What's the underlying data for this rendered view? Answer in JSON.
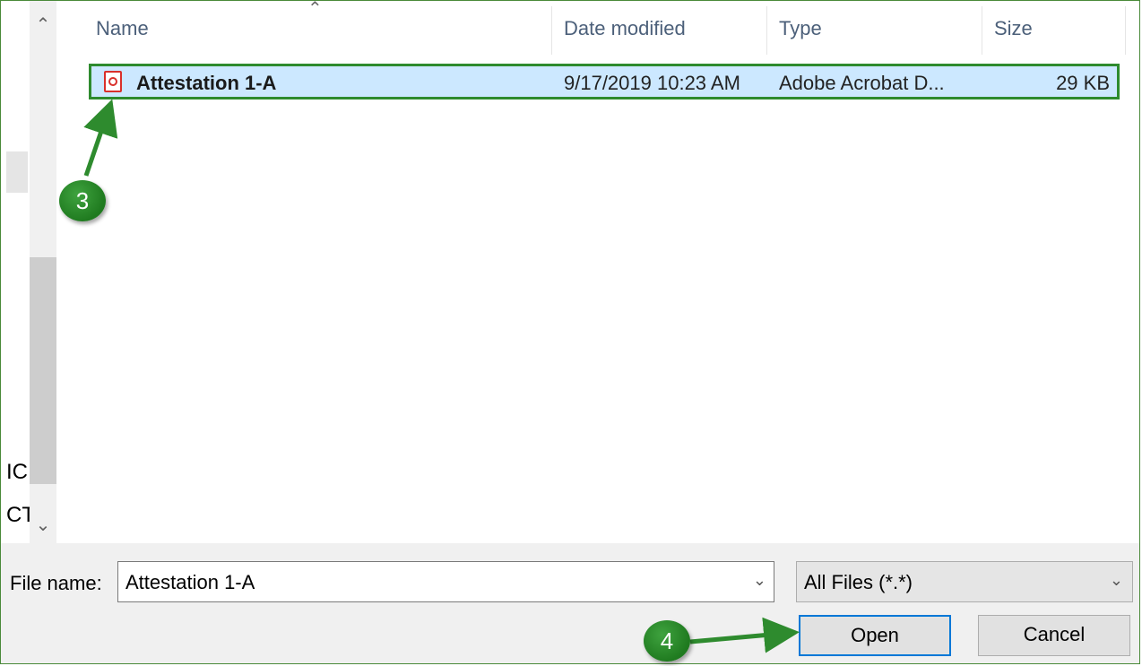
{
  "nav": {
    "cut_text_1": "IC",
    "cut_text_2": "CT"
  },
  "scrollbar": {
    "up_arrow_icon": "chevron-up-icon",
    "down_arrow_icon": "chevron-down-icon"
  },
  "columns": {
    "name": "Name",
    "date": "Date modified",
    "type": "Type",
    "size": "Size"
  },
  "files": [
    {
      "name": "Attestation 1-A",
      "date": "9/17/2019 10:23 AM",
      "type": "Adobe Acrobat D...",
      "size": "29 KB",
      "icon": "pdf-icon",
      "selected": true
    }
  ],
  "callouts": {
    "step3": "3",
    "step4": "4"
  },
  "bottom": {
    "file_name_label": "File name:",
    "file_name_value": "Attestation 1-A",
    "filter_value": "All Files (*.*)",
    "open_label": "Open",
    "cancel_label": "Cancel"
  },
  "colors": {
    "selection": "#cce8ff",
    "highlight_border": "#2e8b2e",
    "accent": "#0078d7",
    "callout": "#1f7a1f"
  }
}
